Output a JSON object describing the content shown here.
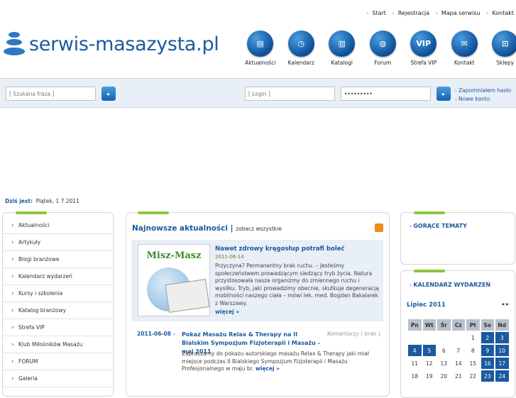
{
  "topnav": [
    "Start",
    "Rejestracja",
    "Mapa serwisu",
    "Kontakt"
  ],
  "logo": {
    "text": "serwis-masazysta.pl"
  },
  "icons": [
    {
      "label": "Aktualności",
      "glyph": "▤",
      "name": "news-icon"
    },
    {
      "label": "Kalendarz",
      "glyph": "◷",
      "name": "calendar-icon"
    },
    {
      "label": "Katalogi",
      "glyph": "▥",
      "name": "folder-icon"
    },
    {
      "label": "Forum",
      "glyph": "◍",
      "name": "forum-icon"
    },
    {
      "label": "Strefa VIP",
      "glyph": "VIP",
      "name": "vip-icon"
    },
    {
      "label": "Kontakt",
      "glyph": "✉",
      "name": "mail-icon"
    },
    {
      "label": "Sklepy",
      "glyph": "⊡",
      "name": "cart-icon"
    }
  ],
  "search": {
    "placeholder": "[ Szukana fraza ]"
  },
  "login": {
    "placeholder": "[ Login ]",
    "password": "•••••••••",
    "forgot": "Zapomniałem hasło",
    "register": "Nowe konto"
  },
  "date": {
    "label": "Dziś jest:",
    "value": "Piątek, 1 7 2011"
  },
  "menu": [
    "Aktualności",
    "Artykuły",
    "Blogi branżowe",
    "Kalendarz wydarzeń",
    "Kursy i szkolenia",
    "Katalog branżowy",
    "Strefa VIP",
    "Klub Miłośników Masażu",
    "FORUM",
    "Galeria"
  ],
  "news": {
    "heading": "Najnowsze aktualności",
    "see_all": "zobacz wszystkie",
    "featured": {
      "logo": "Misz-Masz",
      "title": "Nawet zdrowy kręgosłup potrafi boleć",
      "date": "2011-06-14",
      "text": "Przyczyna? Permanentny brak ruchu. – Jesteśmy społeczeństwem prowadzącym siedzący tryb życia. Natura przystosowała nasze organizmy do zmiennego ruchu i wysiłku. Tryb, jaki prowadzimy obecnie, skutkuje degeneracją mobilności naszego ciała – mówi lek. med. Bogdan Bakalarek z Warszawy.",
      "more": "więcej"
    },
    "item2": {
      "date": "2011-06-08",
      "title": "Pokaz Masażu Relax & Therapy na II Bialskim Sympozjum Fizjoterapii i Masażu - maj 2011",
      "comments": "Komentarzy ( brak )",
      "text": "Zapraszamy do pokazu autorskiego masażu Relax & Therapy jaki miał miejsce podczas II Bialskiego Sympozjum Fizjoterapii i Masażu Profesjonalnego w maju br.",
      "more": "więcej"
    }
  },
  "hot": {
    "title": "GORĄCE TEMATY"
  },
  "calendar": {
    "title": "KALENDARZ WYDARZEŃ",
    "month": "Lipiec 2011",
    "days": [
      "Pn",
      "Wt",
      "Śr",
      "Cz",
      "Pt",
      "So",
      "Nd"
    ],
    "rows": [
      [
        "",
        "",
        "",
        "",
        "1",
        "2",
        "3"
      ],
      [
        "4",
        "5",
        "6",
        "7",
        "8",
        "9",
        "10"
      ],
      [
        "11",
        "12",
        "13",
        "14",
        "15",
        "16",
        "17"
      ],
      [
        "18",
        "19",
        "20",
        "21",
        "22",
        "23",
        "24"
      ]
    ],
    "highlighted": [
      "2",
      "3",
      "4",
      "5",
      "9",
      "10",
      "16",
      "17",
      "23",
      "24"
    ]
  }
}
